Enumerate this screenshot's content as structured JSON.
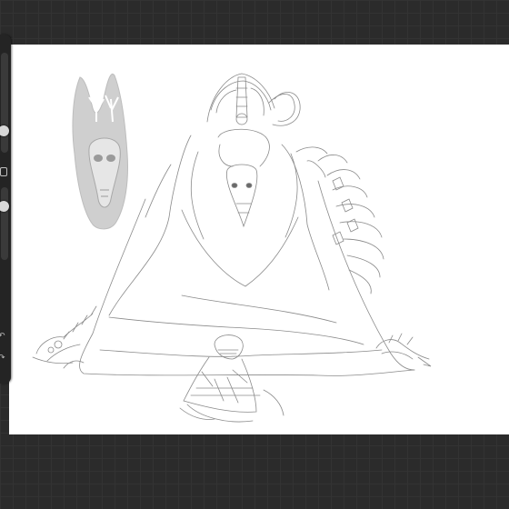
{
  "app": {
    "background_color": "#2b2b2b",
    "canvas_color": "#ffffff",
    "sketch_color": "#8a8a8a",
    "reference_color": "#cfcfcf"
  },
  "sidebar": {
    "brush_size_slider": {
      "value": 0.78
    },
    "modify_button": {
      "icon": "square-icon"
    },
    "opacity_slider": {
      "value": 0.75
    },
    "undo_button": {
      "icon": "undo-arrow-icon"
    },
    "redo_button": {
      "icon": "redo-arrow-icon"
    }
  },
  "canvas": {
    "layers": [
      {
        "name": "reference-sketch",
        "content": "deer-skull-with-antlers"
      },
      {
        "name": "main-sketch",
        "content": "horned-creature-with-spine"
      }
    ]
  }
}
